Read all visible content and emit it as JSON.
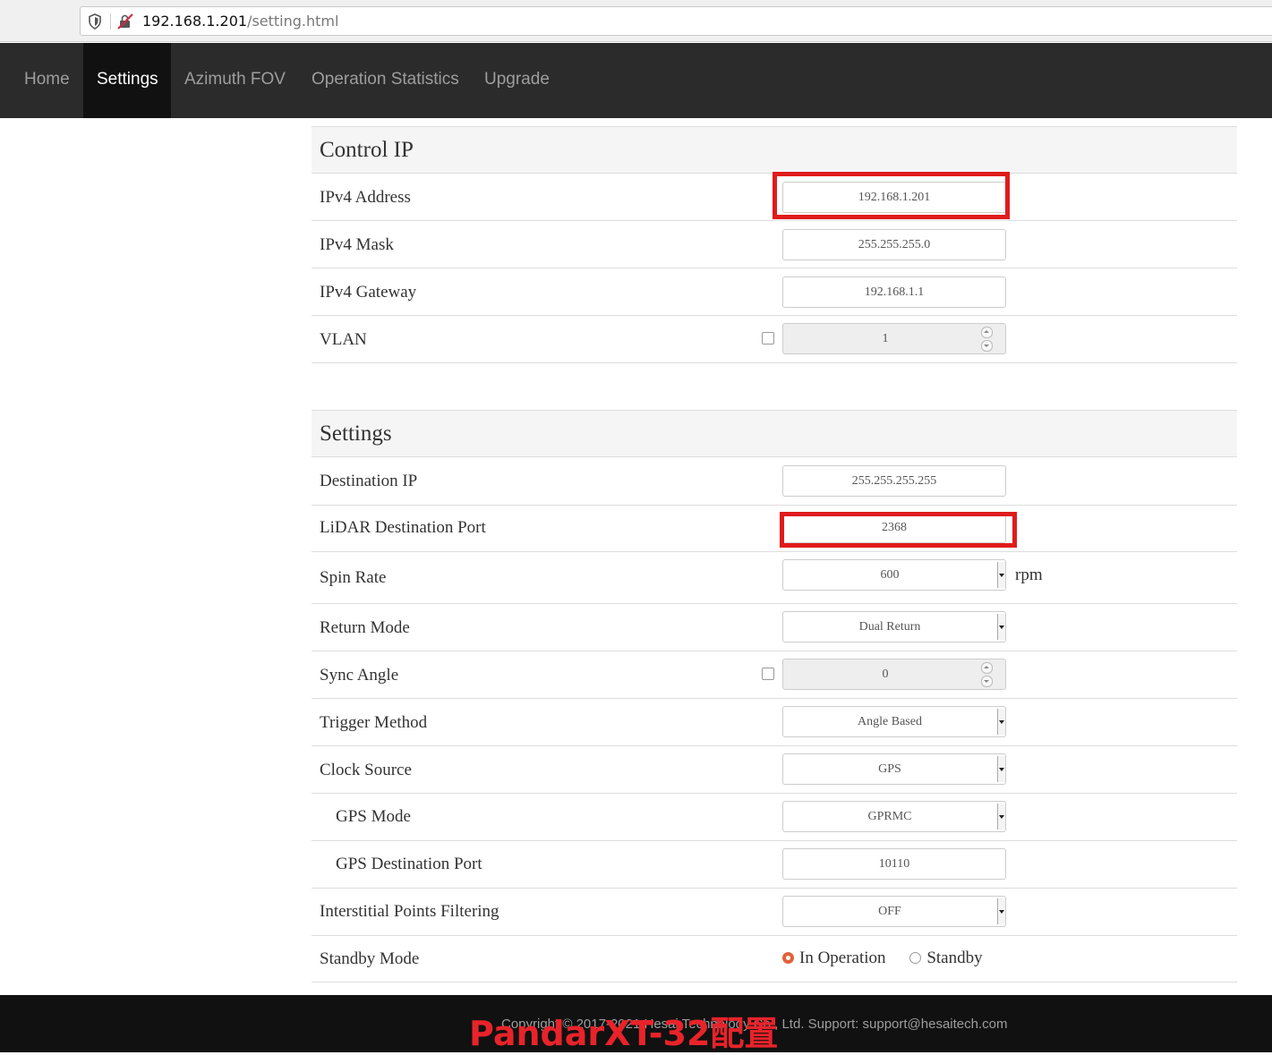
{
  "browser": {
    "url_host": "192.168.1.201",
    "url_path": "/setting.html"
  },
  "nav": {
    "items": [
      {
        "label": "Home",
        "active": false
      },
      {
        "label": "Settings",
        "active": true
      },
      {
        "label": "Azimuth FOV",
        "active": false
      },
      {
        "label": "Operation Statistics",
        "active": false
      },
      {
        "label": "Upgrade",
        "active": false
      }
    ]
  },
  "control_ip": {
    "title": "Control IP",
    "ipv4_address": {
      "label": "IPv4 Address",
      "value": "192.168.1.201"
    },
    "ipv4_mask": {
      "label": "IPv4 Mask",
      "value": "255.255.255.0"
    },
    "ipv4_gateway": {
      "label": "IPv4 Gateway",
      "value": "192.168.1.1"
    },
    "vlan": {
      "label": "VLAN",
      "value": "1",
      "enabled": false
    }
  },
  "settings": {
    "title": "Settings",
    "destination_ip": {
      "label": "Destination IP",
      "value": "255.255.255.255"
    },
    "lidar_destination_port": {
      "label": "LiDAR Destination Port",
      "value": "2368"
    },
    "spin_rate": {
      "label": "Spin Rate",
      "value": "600",
      "unit": "rpm"
    },
    "return_mode": {
      "label": "Return Mode",
      "value": "Dual Return"
    },
    "sync_angle": {
      "label": "Sync Angle",
      "value": "0",
      "enabled": false
    },
    "trigger_method": {
      "label": "Trigger Method",
      "value": "Angle Based"
    },
    "clock_source": {
      "label": "Clock Source",
      "value": "GPS"
    },
    "gps_mode": {
      "label": "GPS Mode",
      "value": "GPRMC"
    },
    "gps_destination_port": {
      "label": "GPS Destination Port",
      "value": "10110"
    },
    "interstitial_points_filtering": {
      "label": "Interstitial Points Filtering",
      "value": "OFF"
    },
    "standby_mode": {
      "label": "Standby Mode",
      "options": [
        "In Operation",
        "Standby"
      ],
      "selected": "In Operation"
    }
  },
  "footer": {
    "text": "Copyright © 2017-2021 Hesai Technology Co., Ltd. Support: support@hesaitech.com",
    "watermark": "PandarXT-32配置"
  },
  "colors": {
    "navbar_bg": "#2b2b2b",
    "nav_active_bg": "#111111",
    "highlight": "#e01b1b",
    "radio_selected": "#e2603a"
  }
}
